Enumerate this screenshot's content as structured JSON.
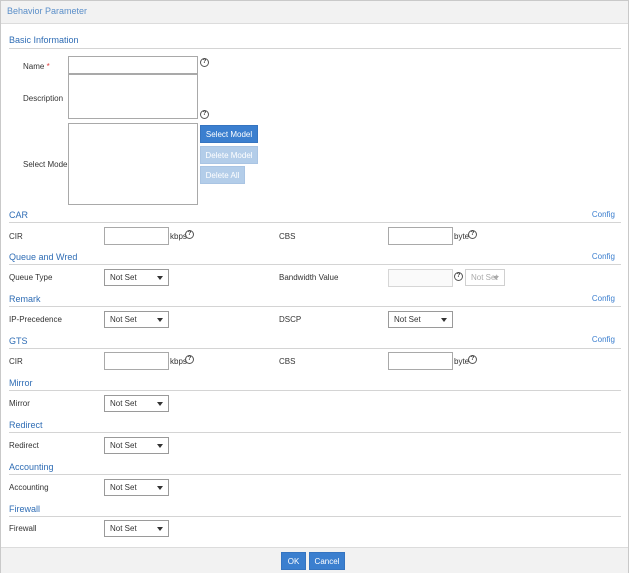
{
  "dialog": {
    "title": "Behavior Parameter"
  },
  "basic": {
    "title": "Basic Information",
    "name_label": "Name",
    "required_mark": "*",
    "name_value": "",
    "description_label": "Description",
    "description_value": "",
    "select_model_label": "Select Model",
    "select_model_button": "Select Model",
    "delete_model_button": "Delete Model",
    "delete_all_button": "Delete All"
  },
  "help_glyph": "?",
  "config_link": "Config",
  "car": {
    "title": "CAR",
    "cir_label": "CIR",
    "cir_unit": "kbps",
    "cbs_label": "CBS",
    "cbs_unit": "byte"
  },
  "queue": {
    "title": "Queue and Wred",
    "type_label": "Queue Type",
    "type_value": "Not Set",
    "bandwidth_label": "Bandwidth Value",
    "bandwidth_unit_value": "Not Set"
  },
  "remark": {
    "title": "Remark",
    "ip_label": "IP-Precedence",
    "ip_value": "Not Set",
    "dscp_label": "DSCP",
    "dscp_value": "Not Set"
  },
  "gts": {
    "title": "GTS",
    "cir_label": "CIR",
    "cir_unit": "kbps",
    "cbs_label": "CBS",
    "cbs_unit": "byte"
  },
  "mirror": {
    "title": "Mirror",
    "label": "Mirror",
    "value": "Not Set"
  },
  "redirect": {
    "title": "Redirect",
    "label": "Redirect",
    "value": "Not Set"
  },
  "accounting": {
    "title": "Accounting",
    "label": "Accounting",
    "value": "Not Set"
  },
  "firewall": {
    "title": "Firewall",
    "label": "Firewall",
    "value": "Not Set"
  },
  "footer": {
    "ok": "OK",
    "cancel": "Cancel"
  }
}
